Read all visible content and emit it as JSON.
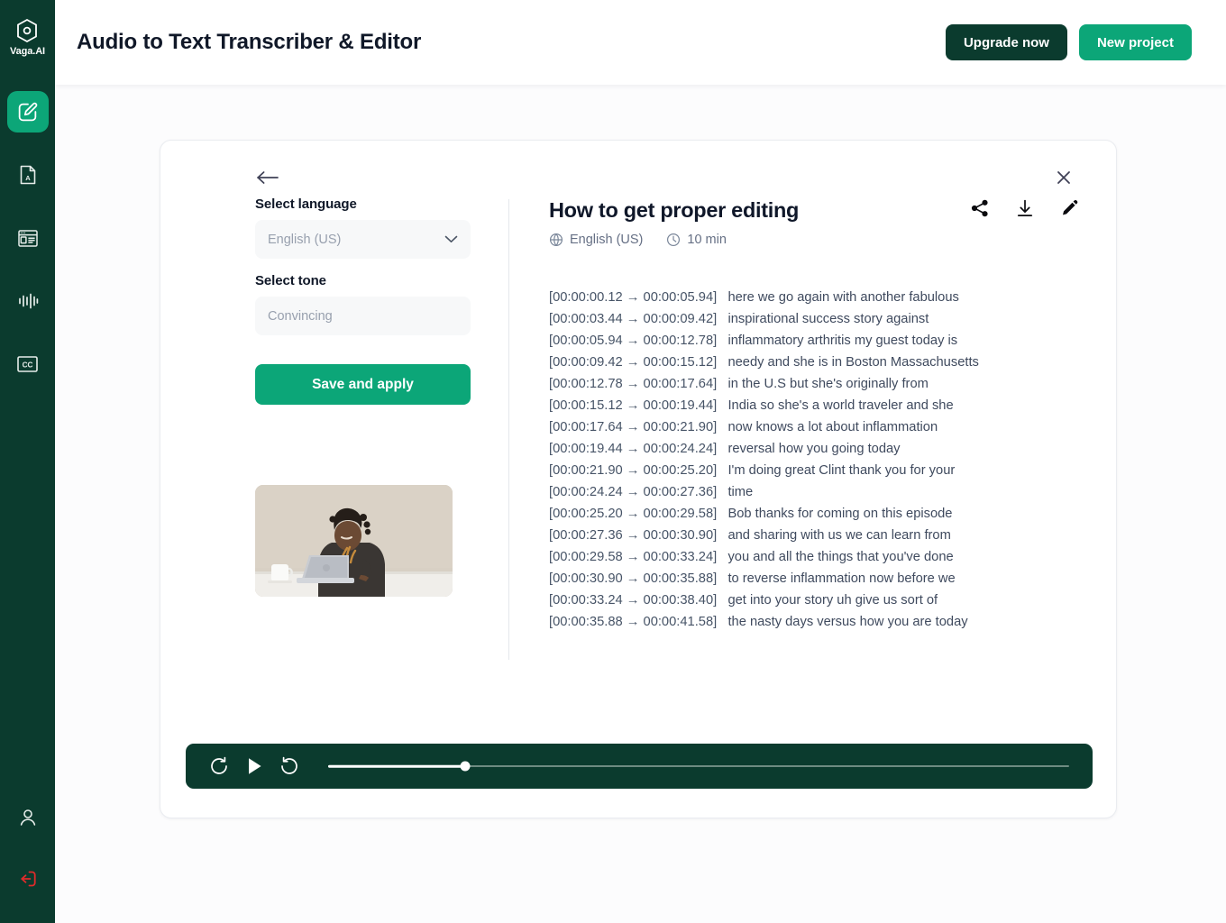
{
  "sidebar": {
    "logo": {
      "icon": "hexagon-logo-icon",
      "text": "Vaga.AI"
    },
    "items": [
      {
        "name": "edit",
        "icon": "edit-pencil-icon",
        "active": true
      },
      {
        "name": "pdf",
        "icon": "pdf-file-icon",
        "active": false
      },
      {
        "name": "templates",
        "icon": "card-layout-icon",
        "active": false
      },
      {
        "name": "audio",
        "icon": "waveform-icon",
        "active": false
      },
      {
        "name": "captions",
        "icon": "closed-caption-icon",
        "active": false
      }
    ],
    "bottom_items": [
      {
        "name": "account",
        "icon": "user-icon"
      },
      {
        "name": "logout",
        "icon": "logout-icon",
        "color": "#E02B2B"
      }
    ]
  },
  "header": {
    "title": "Audio to Text Transcriber & Editor",
    "upgrade_label": "Upgrade now",
    "new_project_label": "New project",
    "upgrade_color": "#0B3B2E",
    "new_project_color": "#0CA678"
  },
  "card": {
    "back_icon": "arrow-left-icon",
    "close_icon": "close-icon",
    "settings": {
      "language_label": "Select language",
      "language_value": "English (US)",
      "tone_label": "Select tone",
      "tone_value": "Convincing",
      "save_label": "Save and apply",
      "chevron_icon": "chevron-down-icon"
    },
    "document": {
      "title": "How to get proper editing",
      "language": "English (US)",
      "duration": "10 min",
      "globe_icon": "globe-icon",
      "clock_icon": "clock-icon",
      "actions": [
        {
          "name": "share",
          "icon": "share-icon"
        },
        {
          "name": "download",
          "icon": "download-icon"
        },
        {
          "name": "edit",
          "icon": "pencil-icon"
        }
      ]
    },
    "transcript": [
      {
        "time": "[00:00:00.12 → 00:00:05.94]",
        "text": "here we go again with another fabulous"
      },
      {
        "time": "[00:00:03.44 → 00:00:09.42]",
        "text": "inspirational success story against"
      },
      {
        "time": "[00:00:05.94 → 00:00:12.78]",
        "text": "inflammatory arthritis my guest today is"
      },
      {
        "time": "[00:00:09.42 → 00:00:15.12]",
        "text": "needy and she is in Boston Massachusetts"
      },
      {
        "time": "[00:00:12.78 → 00:00:17.64]",
        "text": "in the U.S but she's originally from"
      },
      {
        "time": "[00:00:15.12 → 00:00:19.44]",
        "text": "India so she's a world traveler and she"
      },
      {
        "time": "[00:00:17.64 → 00:00:21.90]",
        "text": "now knows a lot about inflammation"
      },
      {
        "time": "[00:00:19.44 → 00:00:24.24]",
        "text": "reversal how you going today"
      },
      {
        "time": "[00:00:21.90 → 00:00:25.20]",
        "text": "I'm doing great Clint thank you for your"
      },
      {
        "time": "[00:00:24.24 → 00:00:27.36]",
        "text": "time"
      },
      {
        "time": "[00:00:25.20 → 00:00:29.58]",
        "text": "Bob thanks for coming on this episode"
      },
      {
        "time": "[00:00:27.36 → 00:00:30.90]",
        "text": "and sharing with us we can learn from"
      },
      {
        "time": "[00:00:29.58 → 00:00:33.24]",
        "text": "you and all the things that you've done"
      },
      {
        "time": "[00:00:30.90 → 00:00:35.88]",
        "text": "to reverse inflammation now before we"
      },
      {
        "time": "[00:00:33.24 → 00:00:38.40]",
        "text": "get into your story uh give us sort of"
      },
      {
        "time": "[00:00:35.88 → 00:00:41.58]",
        "text": "the nasty days versus how you are today"
      }
    ],
    "player": {
      "rewind_icon": "rewind-icon",
      "play_icon": "play-icon",
      "forward_icon": "forward-icon",
      "progress_percent": 18.5,
      "background": "#0B3B2E"
    },
    "thumbnail": {
      "name": "video-thumbnail",
      "alt": "person smiling at laptop"
    }
  }
}
